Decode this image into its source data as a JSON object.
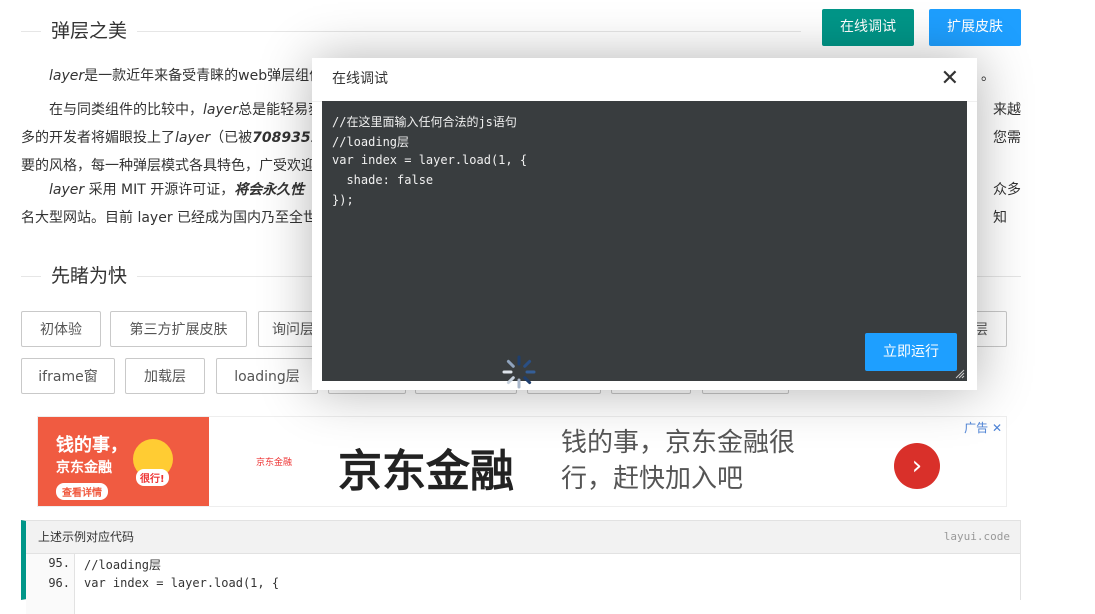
{
  "header": {
    "section1_title": "弹层之美",
    "btn_online": "在线调试",
    "btn_skin": "扩展皮肤"
  },
  "paragraphs": {
    "p1_em": "layer",
    "p1": "是一款近年来备受青睐的web弹层组件",
    "p1_tail": "。",
    "p2_a": "在与同类组件的比较中，",
    "p2_em": "layer",
    "p2_b": "总是能轻易获",
    "p2_tail": "来越",
    "p2_line2a": "多的开发者将媚眼投上了",
    "p2_line2em": "layer",
    "p2_line2b": "（已被",
    "p2_line2num": "7089351",
    "p2_line2tail": "您需",
    "p2_line3": "要的风格，每一种弹层模式各具特色，广受欢迎",
    "p3_em": "layer",
    "p3_a": " 采用 MIT 开源许可证，",
    "p3_bold": "将会永久性",
    "p3_tail": "众多知",
    "p3_line2": "名大型网站。目前 layer 已经成为国内乃至全世"
  },
  "section2": {
    "title": "先睹为快",
    "buttons": [
      "初体验",
      "第三方扩展皮肤",
      "询问层",
      "层",
      "iframe窗",
      "加载层",
      "loading层"
    ]
  },
  "ad": {
    "left_line1": "钱的事，",
    "left_line2": "京东金融",
    "left_btn": "查看详情",
    "left_badge": "很行!",
    "small_logo": "京东金融",
    "brand": "京东金融",
    "slogan": "钱的事，京东金融很行，赶快加入吧",
    "arrow": "›",
    "tag": "广告 ✕"
  },
  "codebox": {
    "title": "上述示例对应代码",
    "tag": "layui.code",
    "lines": [
      {
        "no": "95.",
        "text": "//loading层"
      },
      {
        "no": "96.",
        "text": "var index = layer.load(1, {"
      }
    ]
  },
  "modal": {
    "title": "在线调试",
    "close": "✕",
    "code_lines": [
      "//在这里面输入任何合法的js语句",
      "//loading层",
      "var index = layer.load(1, {",
      "  shade: false",
      "});"
    ],
    "run_label": "立即运行"
  },
  "colors": {
    "teal": "#009688",
    "blue": "#1e9fff",
    "editor_bg": "#393d3f"
  }
}
